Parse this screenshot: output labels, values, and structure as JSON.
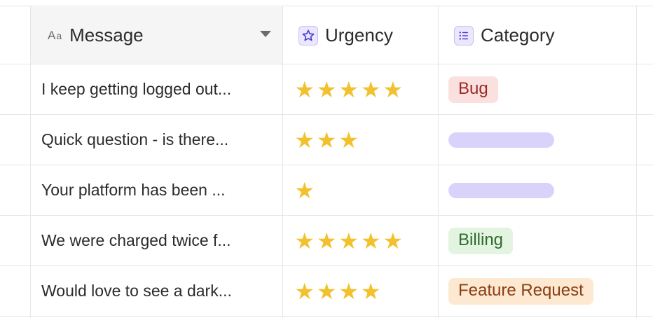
{
  "columns": {
    "message": {
      "label": "Message",
      "icon": "text-field-icon"
    },
    "urgency": {
      "label": "Urgency",
      "icon": "star-field-icon"
    },
    "category": {
      "label": "Category",
      "icon": "list-field-icon"
    }
  },
  "rows": [
    {
      "message": "I keep getting logged out...",
      "urgency": 5,
      "category": "Bug"
    },
    {
      "message": "Quick question - is there...",
      "urgency": 3,
      "category": ""
    },
    {
      "message": "Your platform has been ...",
      "urgency": 1,
      "category": ""
    },
    {
      "message": "We were charged twice f...",
      "urgency": 5,
      "category": "Billing"
    },
    {
      "message": "Would love to see a dark...",
      "urgency": 4,
      "category": "Feature Request"
    }
  ],
  "colors": {
    "star": "#f2c12e",
    "bug_bg": "#fbe0e0",
    "bug_text": "#9b2a22",
    "billing_bg": "#e3f4e1",
    "billing_text": "#2e6b2c",
    "feature_bg": "#fde8d1",
    "feature_text": "#8a3d12",
    "loading_pill": "#d9d3fb"
  }
}
